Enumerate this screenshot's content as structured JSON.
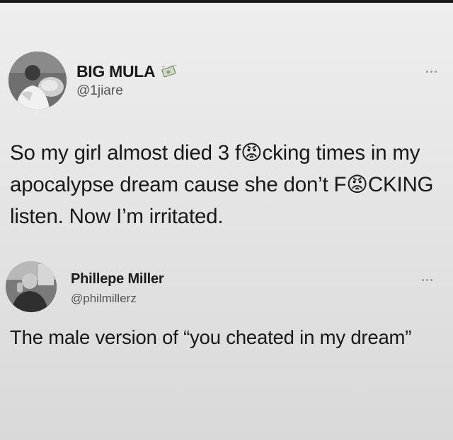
{
  "tweets": [
    {
      "display_name": "BIG MULA",
      "handle": "@1jiare",
      "badge_icon": "money-with-wings-emoji",
      "more_icon": "more-options-icon",
      "text": "So my girl almost died 3 f😡cking times in my apocalypse dream cause she don’t F😡CKING listen. Now I’m irritated."
    },
    {
      "display_name": "Phillepe Miller",
      "handle": "@philmillerz",
      "more_icon": "more-options-icon",
      "text": "The male version of “you cheated in my dream”"
    }
  ],
  "colors": {
    "background": "#e7e7e7",
    "text": "#151515",
    "handle": "#555555"
  }
}
